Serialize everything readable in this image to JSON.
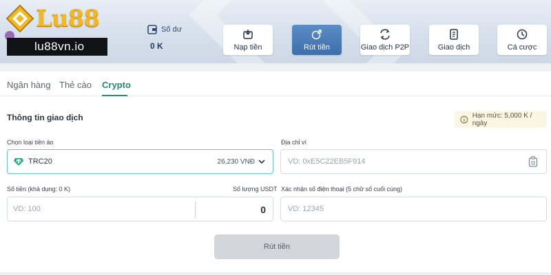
{
  "brand": {
    "logo_text": "Lu88",
    "logo_color": "#f0b825"
  },
  "user": {
    "name": "lu88vn.io"
  },
  "balance": {
    "label": "Số dư",
    "value": "0 K"
  },
  "nav": [
    {
      "label": "Nạp tiền",
      "icon": "deposit-icon",
      "active": false
    },
    {
      "label": "Rút tiền",
      "icon": "withdraw-icon",
      "active": true
    },
    {
      "label": "Giao dịch P2P",
      "icon": "p2p-icon",
      "active": false
    },
    {
      "label": "Giao dịch",
      "icon": "transactions-icon",
      "active": false
    },
    {
      "label": "Cá cược",
      "icon": "bets-icon",
      "active": false
    }
  ],
  "tabs": [
    {
      "label": "Ngân hàng",
      "active": false
    },
    {
      "label": "Thẻ cào",
      "active": false
    },
    {
      "label": "Crypto",
      "active": true
    }
  ],
  "form": {
    "title": "Thông tin giao dịch",
    "limit": "Hạn mức: 5,000 K / ngày",
    "coin_label": "Chọn loại tiền ảo",
    "coin_value": "TRC20",
    "coin_rate": "26,230 VNĐ",
    "wallet_label": "Địa chỉ ví",
    "wallet_placeholder": "VD: 0xE5C22EB5F914",
    "amount_label": "Số tiền (khả dụng: 0 K)",
    "usdt_label": "Số lượng USDT",
    "amount_placeholder": "VD: 100",
    "usdt_value": "0",
    "phone_label": "Xác nhận số điện thoại (5 chữ số cuối cùng)",
    "phone_placeholder": "VD: 12345",
    "submit_label": "Rút tiền"
  },
  "colors": {
    "accent": "#1e8a7a",
    "active_nav": "#4a7bb8",
    "limit_bg": "#fbf5e4"
  }
}
